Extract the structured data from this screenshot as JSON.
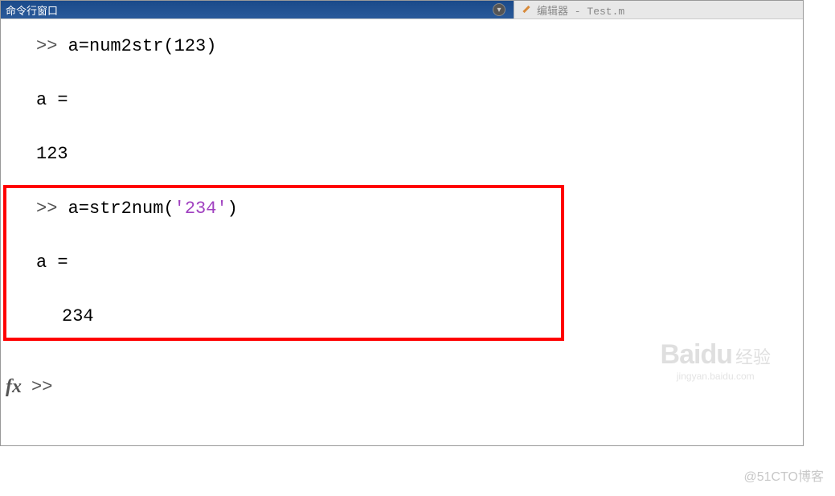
{
  "window": {
    "active_title": "命令行窗口",
    "icon_char": "◉",
    "inactive_tab_label": "编辑器 - Test.m"
  },
  "code": {
    "prompt": ">>",
    "line1_cmd": "a=num2str(123)",
    "result1_var": "a =",
    "result1_val": "123",
    "line2_func": "a=str2num(",
    "line2_arg": "'234'",
    "line2_close": ")",
    "result2_var": "a =",
    "result2_val": "234",
    "fx_label": "fx",
    "cursor_prompt": ">>"
  },
  "watermark": {
    "logo": "Bai",
    "logo2": "du",
    "tag": "经验",
    "sub": "jingyan.baidu.com"
  },
  "footer": {
    "credit": "@51CTO博客"
  }
}
